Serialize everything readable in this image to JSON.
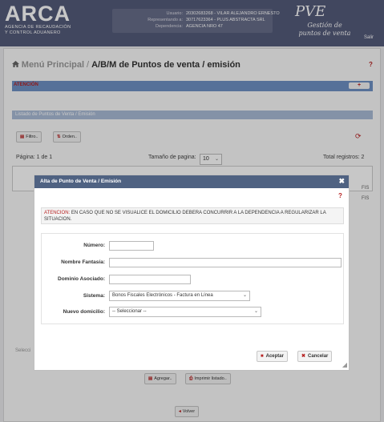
{
  "header": {
    "logo": "ARCA",
    "logo_sub1": "AGENCIA DE RECAUDACIÓN",
    "logo_sub2": "Y CONTROL ADUANERO",
    "user_label": "Usuario:",
    "user_value": "20302683268 - VILAR ALEJANDRO ERNESTO",
    "rep_label": "Representando a:",
    "rep_value": "30717623364 - PLUS ABSTRACTA SRL",
    "dep_label": "Dependencia:",
    "dep_value": "AGENCIA NRO 47",
    "pve": "PVE",
    "pve_sub1": "Gestión de",
    "pve_sub2": "puntos de venta",
    "salir": "Salir"
  },
  "breadcrumb": {
    "home_icon": "home-icon",
    "menu": "Menú Principal",
    "sep": "/",
    "current": "A/B/M de Puntos de venta / emisión",
    "help": "?"
  },
  "atencion": {
    "title": "ATENCIÓN",
    "expand": "+"
  },
  "listado": {
    "title": "Listado de Puntos de Venta / Emisión",
    "filtro": "Filtro..",
    "orden": "Orden..",
    "pagina": "Página: 1 de 1",
    "tamano_label": "Tamaño de pagina:",
    "tamano_value": "10",
    "total": "Total registros: 2",
    "row1_tail": "FIS",
    "row2_tail": "FIS",
    "seleccion": "Selecci"
  },
  "footer": {
    "agregar": "Agregar..",
    "imprimir": "Imprimir listado..",
    "volver": "Volver"
  },
  "dialog": {
    "title": "Alta de Punto de Venta / Emisión",
    "close": "✖",
    "help": "?",
    "warn_label": "ATENCION:",
    "warn_text": " EN CASO QUE NO SE VISUALICE EL DOMICILIO DEBERA CONCURRIR A LA DEPENDENCIA A REGULARIZAR LA SITUACION.",
    "numero_label": "Número:",
    "numero_value": "",
    "fantasia_label": "Nombre Fantasía:",
    "fantasia_value": "",
    "dominio_label": "Dominio Asociado:",
    "dominio_value": "",
    "sistema_label": "Sistema:",
    "sistema_value": "Bonos Fiscales Electrónicos - Factura en Línea",
    "domicilio_label": "Nuevo domicilio:",
    "domicilio_value": "-- Seleccionar --",
    "aceptar": "Aceptar",
    "cancelar": "Cancelar"
  }
}
